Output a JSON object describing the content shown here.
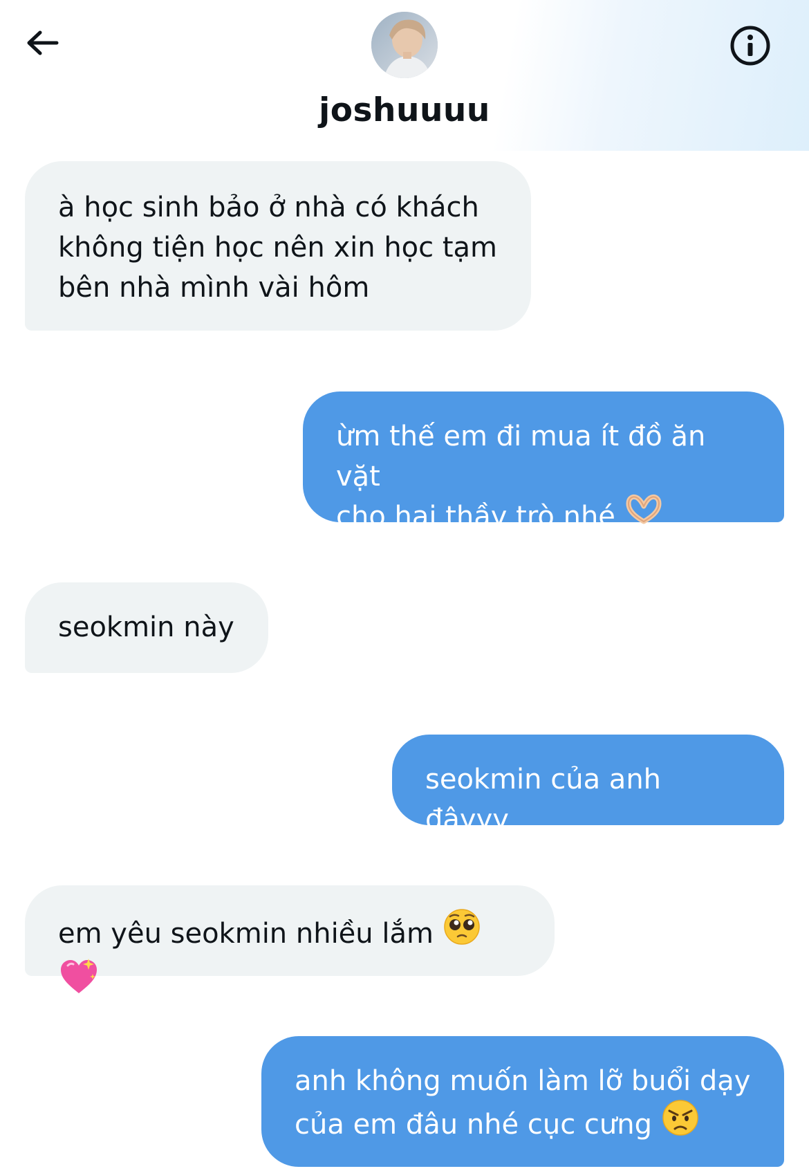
{
  "header": {
    "username": "joshuuuu",
    "back_icon": "arrow-left-icon",
    "info_icon": "info-icon"
  },
  "messages": [
    {
      "direction": "incoming",
      "text": "à học sinh bảo ở nhà có khách\nkhông tiện học nên xin học tạm\nbên nhà mình vài hôm"
    },
    {
      "direction": "outgoing",
      "text": "ừm thế em đi mua ít đồ ăn vặt\ncho hai thầy trò nhé",
      "emojis": [
        "heart-hands-emoji"
      ]
    },
    {
      "direction": "incoming",
      "text": "seokmin này"
    },
    {
      "direction": "outgoing",
      "text": "seokmin của anh đâyyy"
    },
    {
      "direction": "incoming",
      "text": "em yêu seokmin nhiều lắm",
      "emojis": [
        "pleading-face-emoji",
        "sparkling-heart-emoji"
      ]
    },
    {
      "direction": "outgoing",
      "text": "anh không muốn làm lỡ buổi dạy\ncủa em đâu nhé cục cưng",
      "emojis": [
        "angry-face-emoji"
      ]
    }
  ],
  "colors": {
    "incoming_bubble": "#eff3f4",
    "outgoing_bubble": "#4f99e6",
    "text": "#0f1419"
  }
}
